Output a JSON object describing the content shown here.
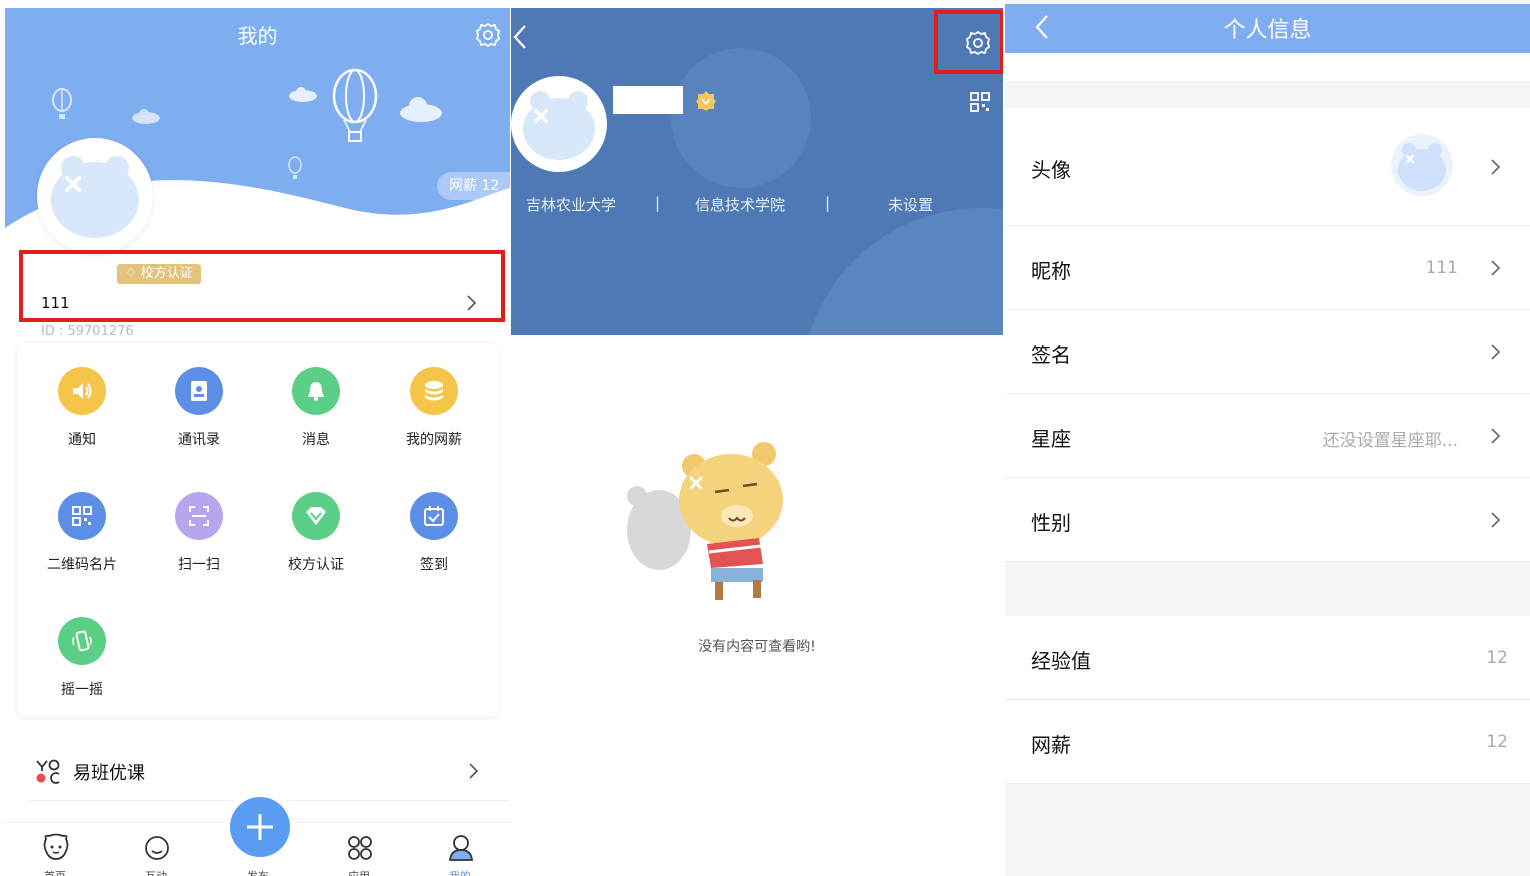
{
  "panel1": {
    "title": "我的",
    "wang_badge": "网薪 12",
    "cert_badge": "校方认证",
    "nickname": "111",
    "user_id": "ID : 59701276",
    "grid": [
      {
        "label": "通知",
        "icon": "speaker-icon",
        "color": "#f5c54a"
      },
      {
        "label": "通讯录",
        "icon": "contacts-icon",
        "color": "#5d8fe6"
      },
      {
        "label": "消息",
        "icon": "bell-icon",
        "color": "#5ccf86"
      },
      {
        "label": "我的网薪",
        "icon": "coins-icon",
        "color": "#f5c54a"
      },
      {
        "label": "二维码名片",
        "icon": "qrcode-icon",
        "color": "#5d8fe6"
      },
      {
        "label": "扫一扫",
        "icon": "scan-icon",
        "color": "#b7a6ee"
      },
      {
        "label": "校方认证",
        "icon": "diamond-icon",
        "color": "#5ccf86"
      },
      {
        "label": "签到",
        "icon": "calendar-check-icon",
        "color": "#5d8fe6"
      },
      {
        "label": "摇一摇",
        "icon": "shake-phone-icon",
        "color": "#5ccf86"
      }
    ],
    "course_label": "易班优课",
    "tabs": [
      {
        "label": "首页",
        "icon": "bear-face-icon"
      },
      {
        "label": "互动",
        "icon": "circle-icon"
      },
      {
        "label": "发布",
        "icon": "plus-icon"
      },
      {
        "label": "应用",
        "icon": "apps-icon"
      },
      {
        "label": "我的",
        "icon": "person-icon"
      }
    ],
    "accent": "#7eaef0"
  },
  "panel2": {
    "university": "吉林农业大学",
    "college": "信息技术学院",
    "major": "未设置",
    "separator": "|",
    "empty_text": "没有内容可查看哟!",
    "header_color": "#4f79b4"
  },
  "panel3": {
    "title": "个人信息",
    "rows": [
      {
        "label": "头像",
        "value": ""
      },
      {
        "label": "昵称",
        "value": "111"
      },
      {
        "label": "签名",
        "value": ""
      },
      {
        "label": "星座",
        "value": "还没设置星座耶..."
      },
      {
        "label": "性别",
        "value": ""
      },
      {
        "label": "经验值",
        "value": "12"
      },
      {
        "label": "网薪",
        "value": "12"
      }
    ]
  }
}
